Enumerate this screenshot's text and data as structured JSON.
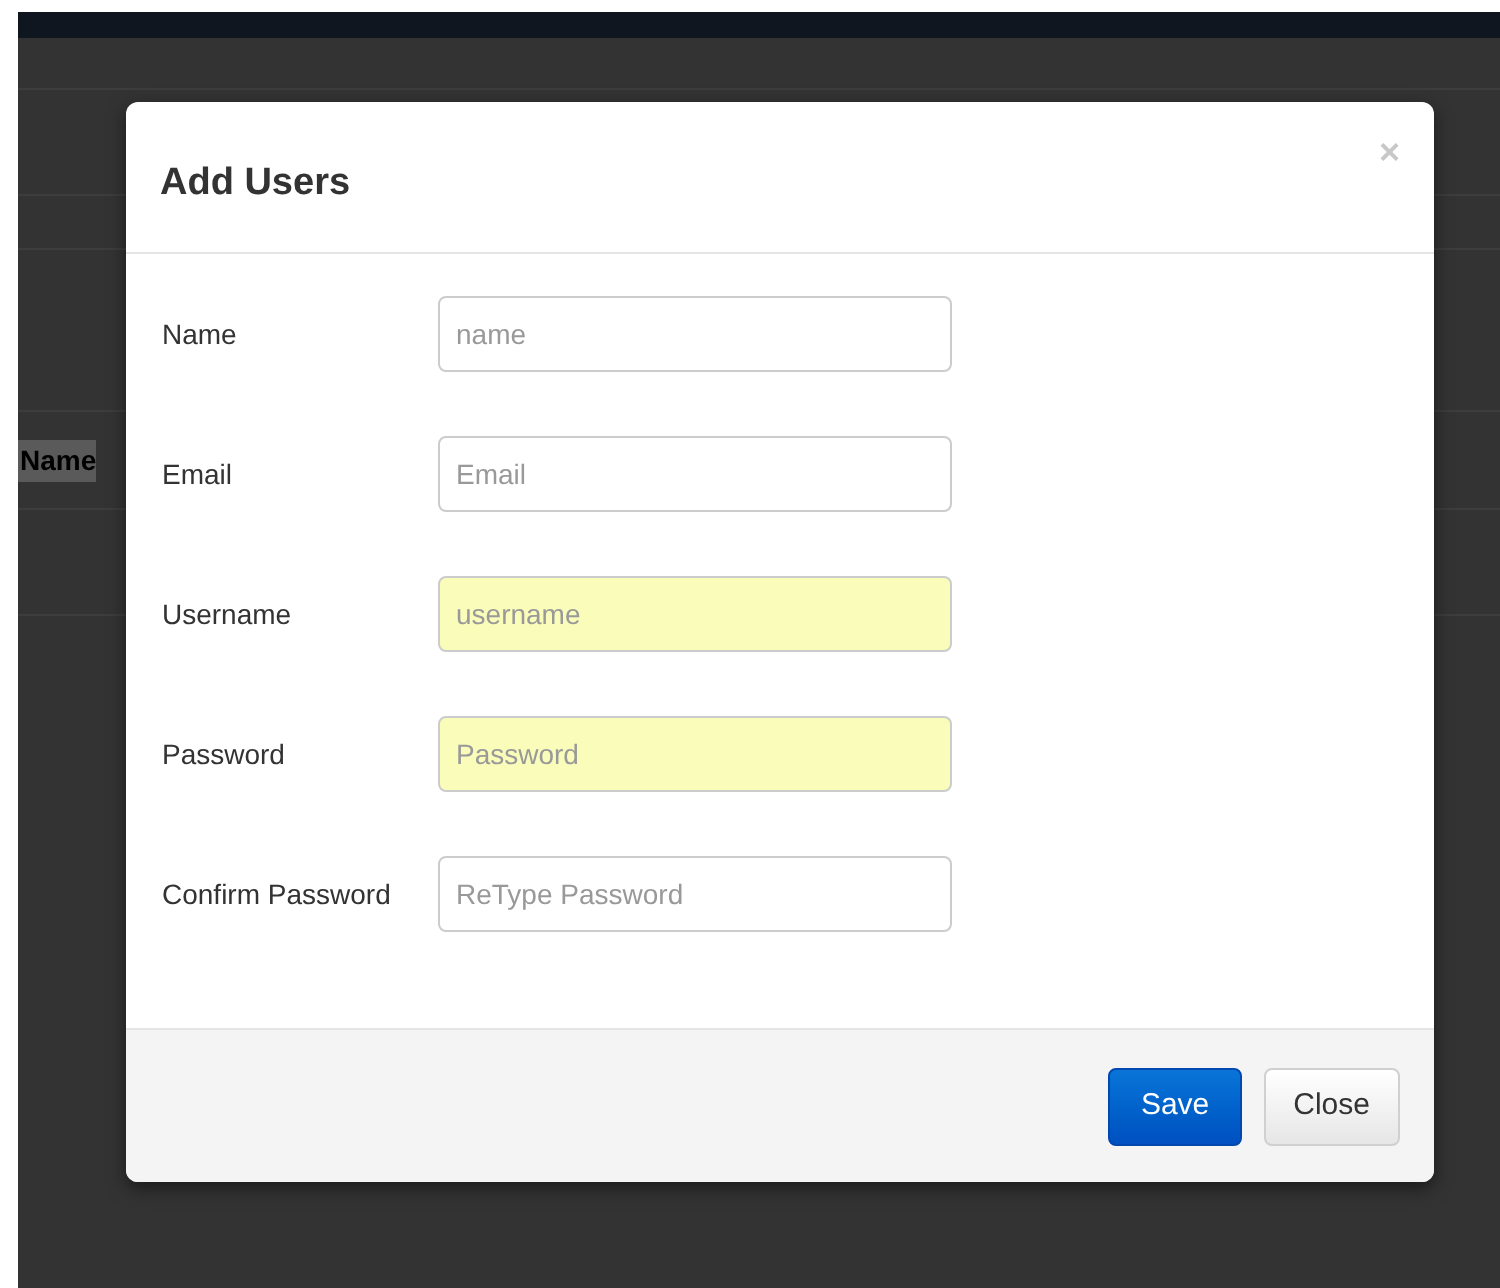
{
  "background_table": {
    "column_header": "Name"
  },
  "modal": {
    "title": "Add Users",
    "close_icon": "×",
    "fields": [
      {
        "label": "Name",
        "placeholder": "name",
        "autofilled": false
      },
      {
        "label": "Email",
        "placeholder": "Email",
        "autofilled": false
      },
      {
        "label": "Username",
        "placeholder": "username",
        "autofilled": true
      },
      {
        "label": "Password",
        "placeholder": "Password",
        "autofilled": true
      },
      {
        "label": "Confirm Password",
        "placeholder": "ReType Password",
        "autofilled": false
      }
    ],
    "buttons": [
      {
        "label": "Save",
        "kind": "primary"
      },
      {
        "label": "Close",
        "kind": "default"
      }
    ]
  }
}
